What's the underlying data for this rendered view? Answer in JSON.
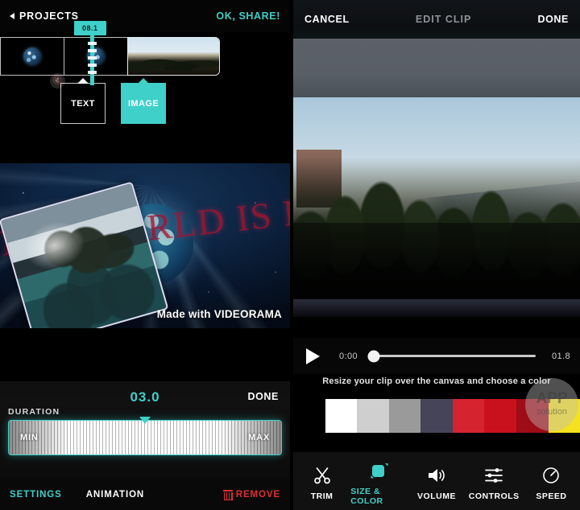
{
  "theme": {
    "accent": "#3fd0c9",
    "danger": "#e03030",
    "bg": "#000000"
  },
  "left": {
    "topbar": {
      "back_label": "PROJECTS",
      "back_icon": "triangle-left-icon",
      "share_label": "OK, SHARE!"
    },
    "timeline": {
      "time_badge": "08.1",
      "mute_icon": "mute-icon",
      "clips": [
        {
          "name": "clip-earth-1",
          "kind": "image"
        },
        {
          "name": "clip-earth-2",
          "kind": "image"
        },
        {
          "name": "clip-photo-3",
          "kind": "video"
        }
      ],
      "tags": [
        {
          "label": "TEXT",
          "active": false
        },
        {
          "label": "IMAGE",
          "active": true
        }
      ]
    },
    "preview": {
      "headline": "THE WORLD IS BEAUTIFUL",
      "watermark": "Made with VIDEORAMA",
      "resize_handle_icon": "resize-horizontal-icon"
    },
    "duration": {
      "value": "03.0",
      "done_label": "DONE",
      "label": "DURATION",
      "min_label": "MIN",
      "max_label": "MAX",
      "knob_percent": 50
    },
    "bottombar": {
      "settings_label": "SETTINGS",
      "animation_label": "ANIMATION",
      "remove_label": "REMOVE",
      "remove_icon": "trash-icon"
    }
  },
  "right": {
    "topbar": {
      "cancel_label": "CANCEL",
      "title": "EDIT CLIP",
      "done_label": "DONE"
    },
    "player": {
      "play_icon": "play-icon",
      "current_time": "0:00",
      "total_time": "01.8",
      "progress_percent": 0
    },
    "hint": "Resize your clip over the canvas and choose a color",
    "palette": [
      {
        "name": "black",
        "hex": "#000000"
      },
      {
        "name": "white",
        "hex": "#ffffff"
      },
      {
        "name": "light-gray",
        "hex": "#cfcfcf"
      },
      {
        "name": "gray",
        "hex": "#9a9a9a"
      },
      {
        "name": "slate-blue",
        "hex": "#454459"
      },
      {
        "name": "red",
        "hex": "#d62330"
      },
      {
        "name": "red-dark",
        "hex": "#c8111c"
      },
      {
        "name": "dark-red",
        "hex": "#9e0d17"
      },
      {
        "name": "yellow",
        "hex": "#f4e11f"
      }
    ],
    "watermark": {
      "line1": "APP",
      "line2": "solution"
    },
    "toolbar": [
      {
        "label": "TRIM",
        "icon": "scissors-icon",
        "active": false
      },
      {
        "label": "SIZE & COLOR",
        "icon": "resize-square-icon",
        "active": true
      },
      {
        "label": "VOLUME",
        "icon": "speaker-icon",
        "active": false
      },
      {
        "label": "CONTROLS",
        "icon": "sliders-icon",
        "active": false
      },
      {
        "label": "SPEED",
        "icon": "gauge-icon",
        "active": false
      }
    ]
  }
}
